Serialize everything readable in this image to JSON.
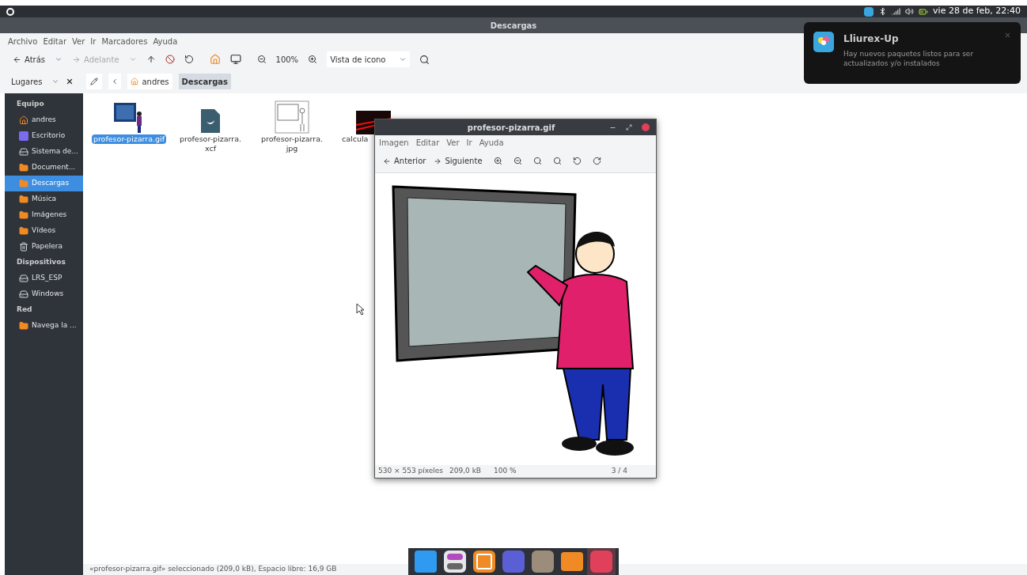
{
  "top_panel": {
    "clock": "vie 28 de feb, 22:40"
  },
  "window": {
    "title": "Descargas"
  },
  "menu": [
    "Archivo",
    "Editar",
    "Ver",
    "Ir",
    "Marcadores",
    "Ayuda"
  ],
  "toolbar": {
    "back": "Atrás",
    "forward": "Adelante",
    "forward_disabled": true,
    "zoom": "100%",
    "view_select": "Vista de icono"
  },
  "location_bar": {
    "places": "Lugares",
    "path": [
      {
        "label": "andres",
        "selected": false
      },
      {
        "label": "Descargas",
        "selected": true
      }
    ]
  },
  "sidebar": [
    {
      "title": "Equipo",
      "items": [
        {
          "label": "andres",
          "kind": "home",
          "selected": false
        },
        {
          "label": "Escritorio",
          "kind": "desktop",
          "selected": false
        },
        {
          "label": "Sistema de...",
          "kind": "drive",
          "selected": false
        },
        {
          "label": "Document...",
          "kind": "folder",
          "selected": false
        },
        {
          "label": "Descargas",
          "kind": "folder",
          "selected": true
        },
        {
          "label": "Música",
          "kind": "folder",
          "selected": false
        },
        {
          "label": "Imágenes",
          "kind": "folder",
          "selected": false
        },
        {
          "label": "Vídeos",
          "kind": "folder",
          "selected": false
        },
        {
          "label": "Papelera",
          "kind": "trash",
          "selected": false
        }
      ]
    },
    {
      "title": "Dispositivos",
      "items": [
        {
          "label": "LRS_ESP",
          "kind": "drive",
          "selected": false
        },
        {
          "label": "Windows",
          "kind": "drive",
          "selected": false
        }
      ]
    },
    {
      "title": "Red",
      "items": [
        {
          "label": "Navega la ...",
          "kind": "folder",
          "selected": false
        }
      ]
    }
  ],
  "files": [
    {
      "lines": [
        "profesor-pizarra.gif"
      ],
      "kind": "color-image",
      "selected": true
    },
    {
      "lines": [
        "profesor-pizarra.",
        "xcf"
      ],
      "kind": "xcf",
      "selected": false
    },
    {
      "lines": [
        "profesor-pizarra.",
        "jpg"
      ],
      "kind": "sketch-image",
      "selected": false
    },
    {
      "lines": [
        "calcula"
      ],
      "kind": "dark-image",
      "selected": false
    }
  ],
  "status_bar": "«profesor-pizarra.gif» seleccionado (209,0 kB), Espacio libre: 16,9 GB",
  "viewer": {
    "title": "profesor-pizarra.gif",
    "menu": [
      "Imagen",
      "Editar",
      "Ver",
      "Ir",
      "Ayuda"
    ],
    "previous": "Anterior",
    "next": "Siguiente",
    "status": {
      "size": "530 × 553 píxeles",
      "filesize": "209,0 kB",
      "zoom": "100 %",
      "position": "3 / 4"
    }
  },
  "notification": {
    "title": "Lliurex-Up",
    "body": "Hay nuevos paquetes listos para ser actualizados y/o instalados"
  },
  "dock": [
    {
      "kind": "desktop",
      "selected": false
    },
    {
      "kind": "settings",
      "selected": false
    },
    {
      "kind": "browser",
      "selected": false
    },
    {
      "kind": "writer",
      "selected": false
    },
    {
      "kind": "gimp",
      "selected": false
    },
    {
      "kind": "files",
      "selected": false
    },
    {
      "kind": "photos",
      "selected": true
    }
  ]
}
